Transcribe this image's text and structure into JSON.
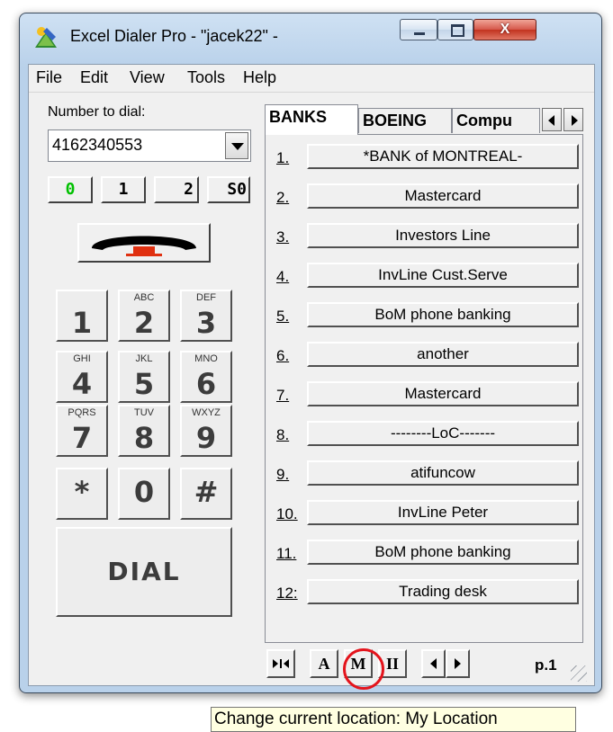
{
  "window": {
    "title": "Excel Dialer Pro - \"jacek22\" -",
    "close_glyph": "X"
  },
  "menu": [
    "File",
    "Edit",
    "View",
    "Tools",
    "Help"
  ],
  "left": {
    "number_label": "Number to dial:",
    "number_value": "4162340553",
    "memory_buttons": [
      "0",
      "1",
      "2",
      "S0"
    ],
    "keypad": [
      {
        "digit": "1",
        "letters": ""
      },
      {
        "digit": "2",
        "letters": "ABC"
      },
      {
        "digit": "3",
        "letters": "DEF"
      },
      {
        "digit": "4",
        "letters": "GHI"
      },
      {
        "digit": "5",
        "letters": "JKL"
      },
      {
        "digit": "6",
        "letters": "MNO"
      },
      {
        "digit": "7",
        "letters": "PQRS"
      },
      {
        "digit": "8",
        "letters": "TUV"
      },
      {
        "digit": "9",
        "letters": "WXYZ"
      },
      {
        "digit": "*",
        "letters": ""
      },
      {
        "digit": "0",
        "letters": ""
      },
      {
        "digit": "#",
        "letters": ""
      }
    ],
    "dial_label": "DIAL"
  },
  "tabs": [
    "BANKS",
    "BOEING",
    "Compu"
  ],
  "speed_dials": [
    {
      "num": "1.",
      "label": "*BANK of MONTREAL-"
    },
    {
      "num": "2.",
      "label": "Mastercard"
    },
    {
      "num": "3.",
      "label": "Investors Line"
    },
    {
      "num": "4.",
      "label": "InvLine Cust.Serve"
    },
    {
      "num": "5.",
      "label": "BoM phone banking"
    },
    {
      "num": "6.",
      "label": "another"
    },
    {
      "num": "7.",
      "label": "Mastercard"
    },
    {
      "num": "8.",
      "label": "--------LoC-------"
    },
    {
      "num": "9.",
      "label": "atifuncow"
    },
    {
      "num": "10.",
      "label": "InvLine Peter"
    },
    {
      "num": "11.",
      "label": "BoM phone banking"
    },
    {
      "num": "12:",
      "label": "Trading desk"
    }
  ],
  "toolbar": {
    "btn_a": "A",
    "btn_m": "M",
    "btn_pause": "II",
    "page": "p.1"
  },
  "tooltip": "Change current location: My Location",
  "colors": {
    "memory_active": "#00c000",
    "highlight_circle": "#e4141c",
    "handset_red": "#e03010"
  },
  "icons": [
    "app-icon",
    "minimize-icon",
    "maximize-icon",
    "close-icon",
    "dropdown-arrow-icon",
    "phone-handset-icon",
    "first-last-icon",
    "scroll-left-icon",
    "scroll-right-icon",
    "resize-grip-icon"
  ]
}
